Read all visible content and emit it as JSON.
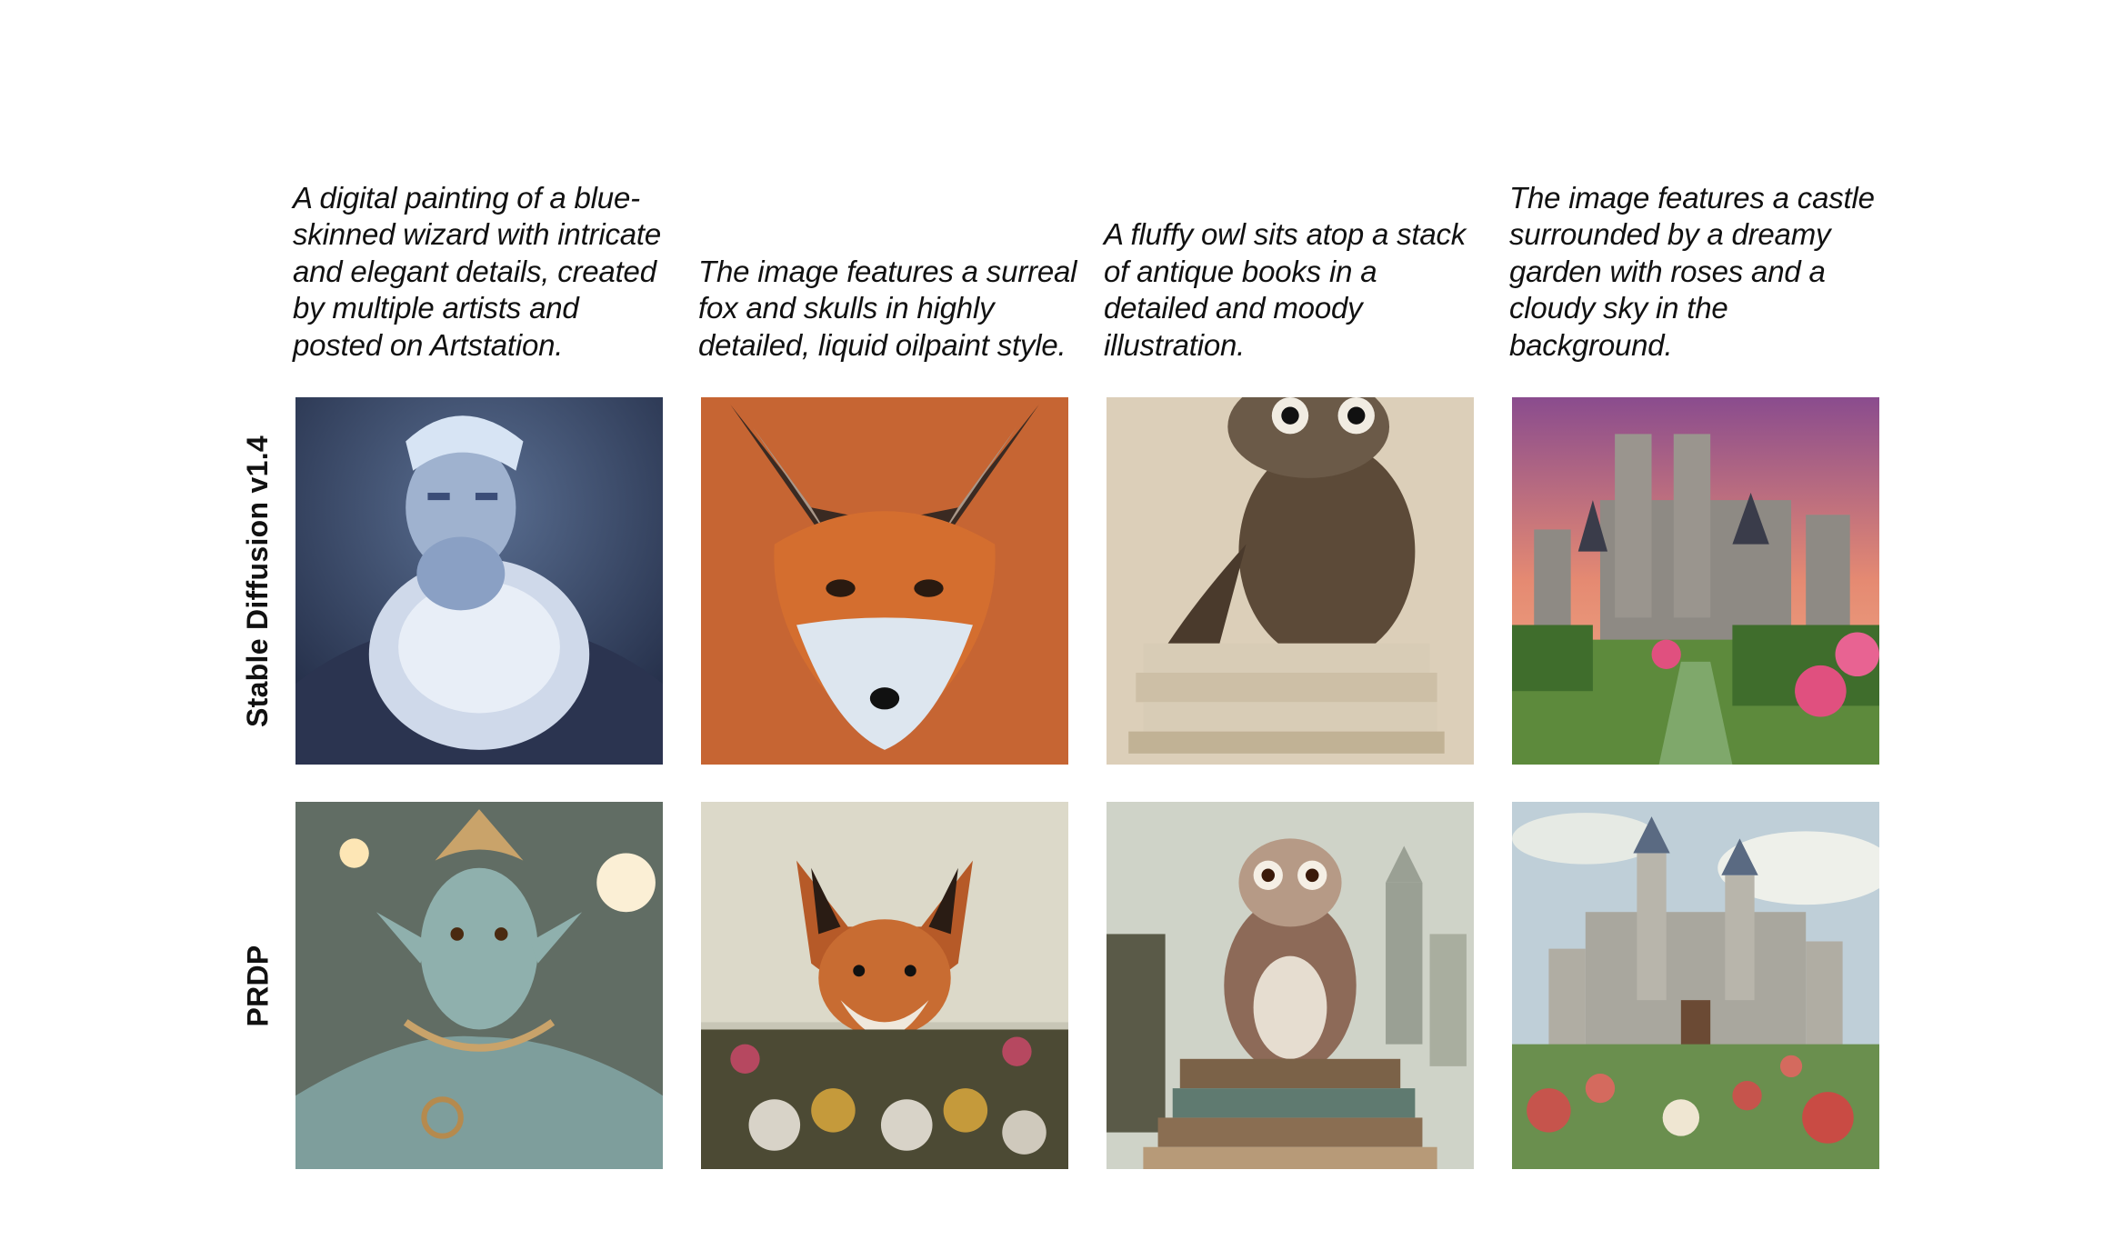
{
  "captions": [
    "A digital painting of a blue-skinned wizard with intricate and elegant details, created by multiple artists and posted on Artstation.",
    "The image features a surreal fox and skulls in highly detailed, liquid oilpaint style.",
    "A fluffy owl sits atop a stack of antique books in a detailed and moody illustration.",
    "The image features a castle surrounded by a dreamy garden with roses and a cloudy sky in the background."
  ],
  "rows": [
    {
      "label": "Stable Diffusion v1.4"
    },
    {
      "label": "PRDP"
    }
  ],
  "palette": {
    "sd_wizard": "#8fa3c4",
    "sd_fox": "#c65a25",
    "sd_owl": "#c9b99c",
    "sd_castle": "#c36a7a",
    "prdp_wizard": "#7f9a9a",
    "prdp_fox": "#b9683a",
    "prdp_owl": "#b9b2a0",
    "prdp_castle": "#9fb2c0"
  }
}
